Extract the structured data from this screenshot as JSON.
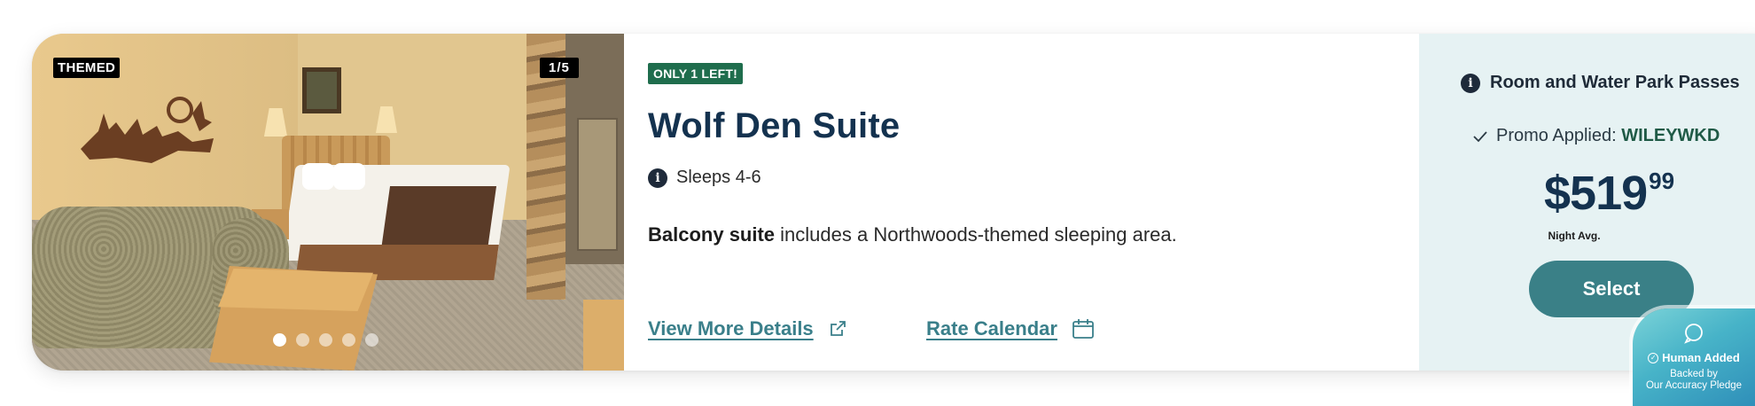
{
  "photo": {
    "tag": "THEMED",
    "counter": "1/5",
    "slides": 5,
    "active_slide": 1
  },
  "room": {
    "availability_badge": "ONLY 1 LEFT!",
    "name": "Wolf Den Suite",
    "sleeps": "Sleeps 4-6",
    "desc_bold": "Balcony suite",
    "desc_rest": " includes a Northwoods-themed sleeping area.",
    "details_link": "View More Details",
    "calendar_link": "Rate Calendar"
  },
  "pricing": {
    "package": "Room and Water Park Passes",
    "promo_label": "Promo Applied: ",
    "promo_code": "WILEYWKD",
    "price_main": "$519",
    "price_cents": "99",
    "price_note": "Night Avg.",
    "select_label": "Select"
  },
  "pledge": {
    "title": "Human Added",
    "line1": "Backed by",
    "line2": "Our Accuracy Pledge"
  },
  "colors": {
    "title_navy": "#14324f",
    "badge_green": "#1f6d4d",
    "link_teal": "#3a7f8a",
    "select_teal": "#3a8087",
    "price_panel_bg": "#e6f2f3"
  }
}
